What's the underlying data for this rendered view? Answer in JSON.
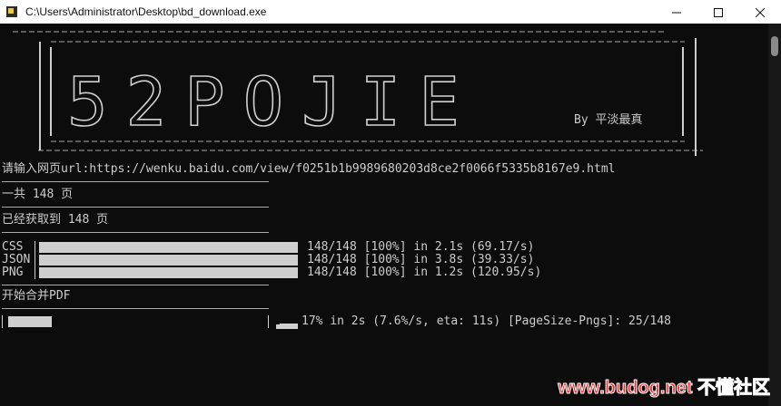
{
  "window": {
    "title": "C:\\Users\\Administrator\\Desktop\\bd_download.exe"
  },
  "banner": {
    "logo_text": "52POJIE",
    "author": "By 平淡最真"
  },
  "console": {
    "url_prompt": "请输入网页url:https://wenku.baidu.com/view/f0251b1b9989680203d8ce2f0066f5335b8167e9.html",
    "total_pages": "一共 148 页",
    "fetched": "已经获取到 148 页",
    "downloads": [
      {
        "label": "CSS",
        "status": "148/148 [100%] in 2.1s (69.17/s)",
        "progress": 1.0
      },
      {
        "label": "JSON",
        "status": "148/148 [100%] in 3.8s (39.33/s)",
        "progress": 1.0
      },
      {
        "label": "PNG",
        "status": "148/148 [100%] in 1.2s (120.95/s)",
        "progress": 1.0
      }
    ],
    "merge_start": "开始合并PDF",
    "merge_progress": {
      "status": "17% in 2s (7.6%/s, eta: 11s) [PageSize-Pngs]: 25/148",
      "fraction": 0.17
    }
  },
  "watermark": {
    "site": "www.budog.net",
    "name": "不懂社区"
  }
}
